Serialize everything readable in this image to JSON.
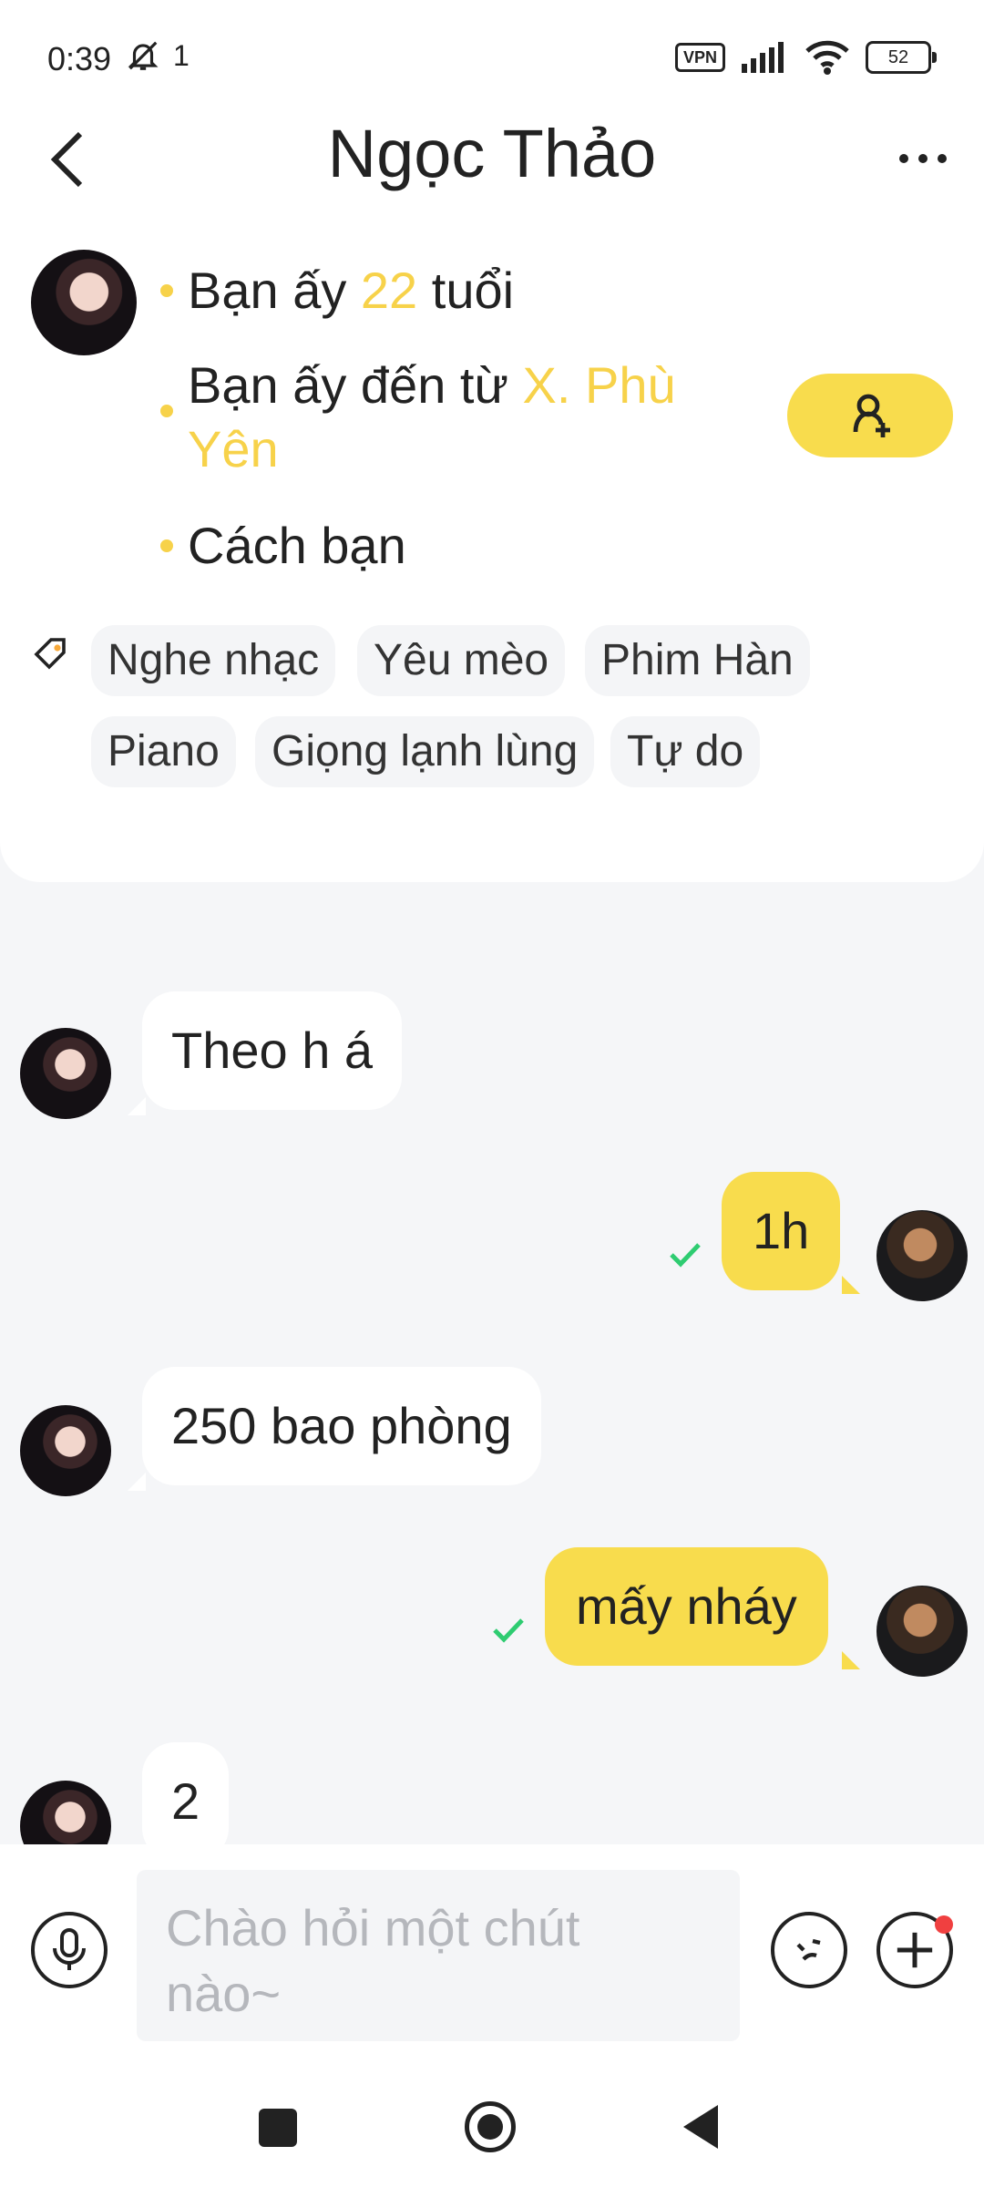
{
  "status_bar": {
    "time": "0:39",
    "notif_count": "1",
    "vpn": "VPN",
    "battery": "52"
  },
  "header": {
    "title": "Ngọc Thảo"
  },
  "profile": {
    "age_prefix": "Bạn ấy ",
    "age_value": "22",
    "age_suffix": " tuổi",
    "from_prefix": "Bạn ấy đến từ ",
    "from_value_line1": "X. Phù",
    "from_value_line2": "Yên",
    "distance": "Cách bạn"
  },
  "tags": [
    "Nghe nhạc",
    "Yêu mèo",
    "Phim Hàn",
    "Piano",
    "Giọng lạnh lùng",
    "Tự do"
  ],
  "messages": [
    {
      "side": "in",
      "text": "Theo h á"
    },
    {
      "side": "out",
      "text": "1h"
    },
    {
      "side": "in",
      "text": "250 bao phòng"
    },
    {
      "side": "out",
      "text": "mấy nháy"
    },
    {
      "side": "in",
      "text": "2"
    }
  ],
  "input": {
    "placeholder_line1": "Chào hỏi một chút",
    "placeholder_line2": "nào~"
  },
  "colors": {
    "accent": "#f8dc4d",
    "highlight_text": "#f7d24a",
    "read_check": "#2ecc71",
    "badge": "#f04040"
  }
}
